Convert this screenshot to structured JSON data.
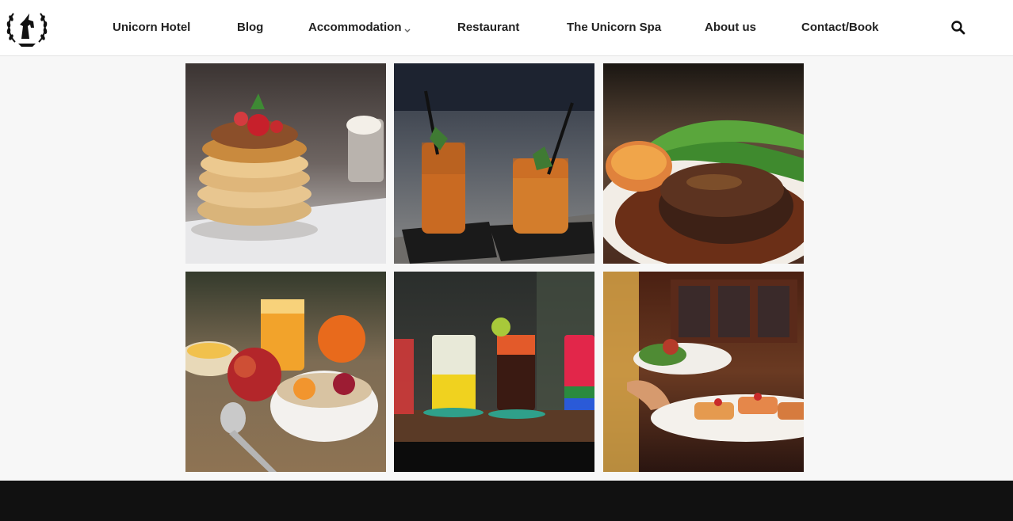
{
  "header": {
    "nav": [
      {
        "label": "Unicorn Hotel"
      },
      {
        "label": "Blog"
      },
      {
        "label": "Accommodation"
      },
      {
        "label": "Restaurant"
      },
      {
        "label": "The Unicorn Spa"
      },
      {
        "label": "About us"
      },
      {
        "label": "Contact/Book"
      }
    ]
  },
  "icons": {
    "logo": "unicorn-laurel-logo",
    "dropdown": "chevron-down-icon",
    "search": "search-icon"
  },
  "colors": {
    "header_bg": "#ffffff",
    "page_bg": "#f7f7f7",
    "footer_bg": "#111111",
    "nav_text": "#222222"
  }
}
